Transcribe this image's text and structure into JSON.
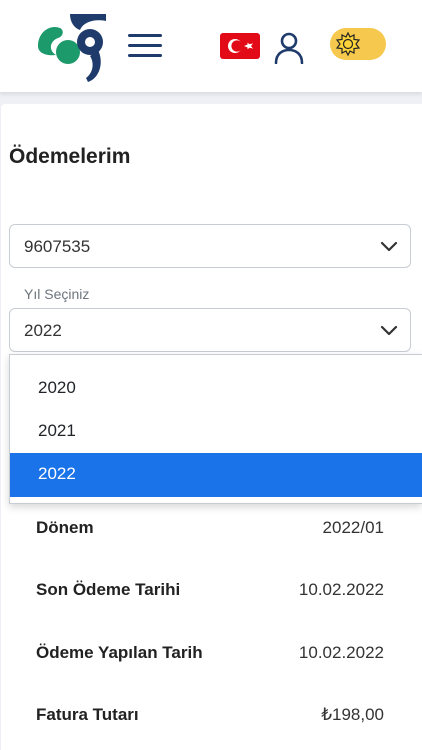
{
  "header": {
    "logo_icon": "brand-logo-icon",
    "menu_icon": "hamburger-menu-icon",
    "language_icon": "turkey-flag-icon",
    "user_icon": "user-icon",
    "theme_icon": "sun-icon"
  },
  "colors": {
    "accent_blue": "#1a73e8",
    "nav_navy": "#1f3b6b",
    "toggle_yellow": "#f6c84e",
    "flag_red": "#e30a17",
    "logo_green": "#1d9a6c",
    "logo_navy": "#1f3b6b"
  },
  "page": {
    "title": "Ödemelerim"
  },
  "subscriber_select": {
    "value": "9607535"
  },
  "year_select": {
    "label": "Yıl Seçiniz",
    "value": "2022",
    "options": [
      "2020",
      "2021",
      "2022"
    ],
    "selected_index": 2
  },
  "payment": {
    "rows": [
      {
        "label": "Dönem",
        "value": "2022/01"
      },
      {
        "label": "Son Ödeme Tarihi",
        "value": "10.02.2022"
      },
      {
        "label": "Ödeme Yapılan Tarih",
        "value": "10.02.2022"
      },
      {
        "label": "Fatura Tutarı",
        "value": "₺198,00"
      }
    ]
  }
}
